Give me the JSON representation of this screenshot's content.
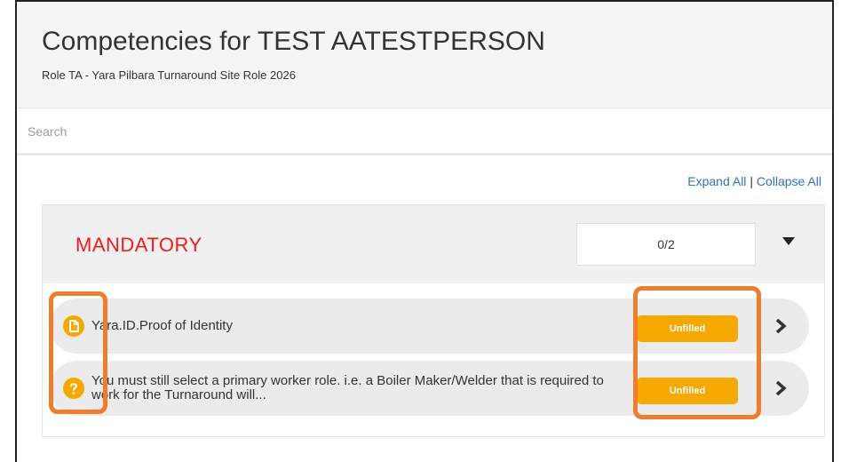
{
  "header": {
    "title": "Competencies for TEST AATESTPERSON",
    "subtitle": "Role TA - Yara Pilbara Turnaround Site Role 2026"
  },
  "search": {
    "placeholder": "Search"
  },
  "controls": {
    "expand_all": "Expand All",
    "separator": "|",
    "collapse_all": "Collapse All"
  },
  "section": {
    "title": "MANDATORY",
    "progress": "0/2",
    "items": [
      {
        "icon": "document-icon",
        "label": "Yara.ID.Proof of Identity",
        "status": "Unfilled"
      },
      {
        "icon": "question-icon",
        "label": "You must still select a primary worker role. i.e. a Boiler Maker/Welder that is required to work for the Turnaround will...",
        "status": "Unfilled"
      }
    ]
  },
  "colors": {
    "accent": "#f5a800",
    "title_red": "#ee1c1c",
    "link": "#2f74b5",
    "highlight": "#f07c2e"
  }
}
